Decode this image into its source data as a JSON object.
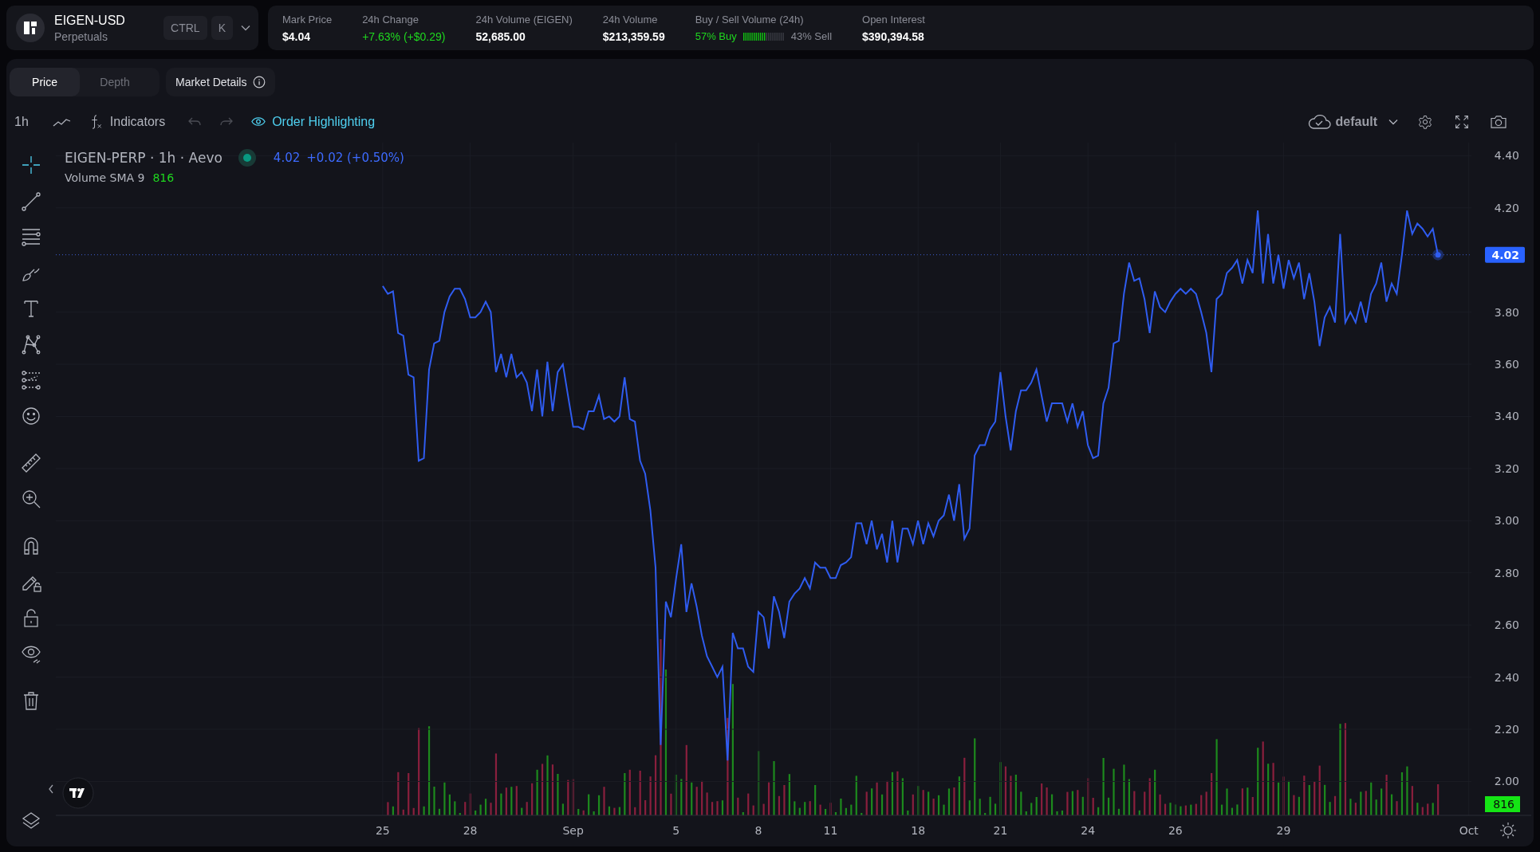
{
  "market": {
    "symbol": "EIGEN-USD",
    "type": "Perpetuals",
    "shortcut_keys": [
      "CTRL",
      "K"
    ]
  },
  "stats": [
    {
      "kind": "plain",
      "label": "Mark Price",
      "value": "$4.04"
    },
    {
      "kind": "change",
      "label": "24h Change",
      "value": "+7.63% (+$0.29)"
    },
    {
      "kind": "plain",
      "label": "24h Volume (EIGEN)",
      "value": "52,685.00"
    },
    {
      "kind": "plain",
      "label": "24h Volume",
      "value": "$213,359.59"
    },
    {
      "kind": "buysell",
      "label": "Buy / Sell Volume (24h)",
      "buy": "57% Buy",
      "sell": "43% Sell",
      "level": 0.57
    },
    {
      "kind": "plain",
      "label": "Open Interest",
      "value": "$390,394.58"
    }
  ],
  "tabs": [
    {
      "label": "Price",
      "selected": true
    },
    {
      "label": "Depth",
      "selected": false
    }
  ],
  "market_details": "Market Details",
  "toolbar": {
    "interval": "1h",
    "indicators": "Indicators",
    "undo_disabled": true,
    "redo_disabled": true,
    "order_highlighting": {
      "label": "Order Highlighting",
      "on": true
    },
    "layout": "default"
  },
  "tools": [
    {
      "kind": "crosshair",
      "selected": true
    },
    {
      "kind": "trendline",
      "selected": false
    },
    {
      "kind": "hlines",
      "selected": false
    },
    {
      "kind": "brush",
      "selected": false
    },
    {
      "kind": "text",
      "selected": false
    },
    {
      "kind": "pattern",
      "selected": false
    },
    {
      "kind": "forecast",
      "selected": false
    },
    {
      "kind": "smiley",
      "selected": false
    },
    {
      "kind": "ruler",
      "selected": false
    },
    {
      "kind": "zoom",
      "selected": false
    },
    {
      "kind": "magnet",
      "selected": false
    },
    {
      "kind": "drawlock",
      "selected": false
    },
    {
      "kind": "lock",
      "selected": false
    },
    {
      "kind": "eye",
      "selected": false
    },
    {
      "kind": "trash",
      "selected": false
    }
  ],
  "chart": {
    "legend": {
      "title": "EIGEN-PERP · 1h · Aevo",
      "price": "4.02",
      "change": "+0.02 (+0.50%)",
      "indicator": "Volume SMA 9",
      "indicator_value": "816"
    },
    "last_price": "4.02",
    "volume_label": "816",
    "chart_data": {
      "type": "line",
      "grid": true,
      "ylim": [
        1.87,
        4.45
      ],
      "categories": [
        null,
        null,
        null,
        null,
        null,
        null,
        null,
        null,
        null,
        null,
        null,
        null,
        null,
        null,
        null,
        null,
        null,
        null,
        null,
        null,
        null,
        null,
        null,
        null,
        null,
        null,
        null,
        null,
        null,
        null,
        null,
        null,
        null,
        null,
        null,
        null,
        null,
        null,
        null,
        null,
        null,
        null,
        null,
        null,
        null,
        null,
        null,
        null,
        null,
        null,
        null,
        null,
        null,
        null,
        null,
        null,
        null,
        null,
        null,
        null,
        null,
        null,
        null,
        "25",
        null,
        null,
        null,
        null,
        null,
        null,
        null,
        null,
        null,
        null,
        null,
        null,
        null,
        null,
        null,
        null,
        "28",
        null,
        null,
        null,
        null,
        null,
        null,
        null,
        null,
        null,
        null,
        null,
        null,
        null,
        null,
        null,
        null,
        null,
        null,
        null,
        "Sep",
        null,
        null,
        null,
        null,
        null,
        null,
        null,
        null,
        null,
        null,
        null,
        null,
        null,
        null,
        null,
        null,
        null,
        null,
        null,
        "5",
        null,
        null,
        null,
        null,
        null,
        null,
        null,
        null,
        null,
        null,
        null,
        null,
        null,
        null,
        null,
        "8",
        null,
        null,
        null,
        null,
        null,
        null,
        null,
        null,
        null,
        null,
        null,
        null,
        null,
        "11",
        null,
        null,
        null,
        null,
        null,
        null,
        null,
        null,
        null,
        null,
        null,
        null,
        null,
        null,
        null,
        null,
        "18",
        null,
        null,
        null,
        null,
        null,
        null,
        null,
        null,
        null,
        null,
        null,
        null,
        null,
        null,
        null,
        "21",
        null,
        null,
        null,
        null,
        null,
        null,
        null,
        null,
        null,
        null,
        null,
        null,
        null,
        null,
        null,
        null,
        "24",
        null,
        null,
        null,
        null,
        null,
        null,
        null,
        null,
        null,
        null,
        null,
        null,
        null,
        null,
        null,
        null,
        "26",
        null,
        null,
        null,
        null,
        null,
        null,
        null,
        null,
        null,
        null,
        null,
        null,
        null,
        null,
        null,
        null,
        null,
        null,
        null,
        null,
        "29",
        null,
        null,
        null,
        null,
        null,
        null,
        null,
        null,
        null,
        null,
        null,
        null,
        null,
        null,
        null,
        null,
        null,
        null,
        null,
        null,
        null,
        null,
        null,
        null,
        null,
        null,
        null,
        null,
        null,
        null,
        null,
        null,
        null,
        null,
        null,
        "Oct"
      ],
      "yticks": [
        {
          "value": 4.4,
          "label": "4.40"
        },
        {
          "value": 4.2,
          "label": "4.20"
        },
        {
          "value": 3.8,
          "label": "3.80"
        },
        {
          "value": 3.6,
          "label": "3.60"
        },
        {
          "value": 3.4,
          "label": "3.40"
        },
        {
          "value": 3.2,
          "label": "3.20"
        },
        {
          "value": 3.0,
          "label": "3.00"
        },
        {
          "value": 2.8,
          "label": "2.80"
        },
        {
          "value": 2.6,
          "label": "2.60"
        },
        {
          "value": 2.4,
          "label": "2.40"
        },
        {
          "value": 2.2,
          "label": "2.20"
        },
        {
          "value": 2.0,
          "label": "2.00"
        }
      ],
      "series": [
        {
          "color": "#2f5cf0",
          "values": [
            null,
            null,
            null,
            null,
            null,
            null,
            null,
            null,
            null,
            null,
            null,
            null,
            null,
            null,
            null,
            null,
            null,
            null,
            null,
            null,
            null,
            null,
            null,
            null,
            null,
            null,
            null,
            null,
            null,
            null,
            null,
            null,
            null,
            null,
            null,
            null,
            null,
            null,
            null,
            null,
            null,
            null,
            null,
            null,
            null,
            null,
            null,
            null,
            null,
            null,
            null,
            null,
            null,
            null,
            null,
            null,
            null,
            null,
            null,
            null,
            null,
            null,
            null,
            3.9,
            3.87,
            3.88,
            3.72,
            3.71,
            3.56,
            3.55,
            3.23,
            3.24,
            3.58,
            3.68,
            3.69,
            3.8,
            3.86,
            3.89,
            3.89,
            3.85,
            3.78,
            3.78,
            3.8,
            3.84,
            3.8,
            3.57,
            3.64,
            3.55,
            3.64,
            3.55,
            3.57,
            3.53,
            3.42,
            3.58,
            3.4,
            3.61,
            3.42,
            3.57,
            3.6,
            3.48,
            3.36,
            3.36,
            3.35,
            3.42,
            3.42,
            3.48,
            3.39,
            3.4,
            3.38,
            3.4,
            3.55,
            3.39,
            3.38,
            3.23,
            3.18,
            3.04,
            2.82,
            2.14,
            2.69,
            2.63,
            2.78,
            2.91,
            2.65,
            2.76,
            2.67,
            2.56,
            2.48,
            2.44,
            2.4,
            2.44,
            2.08,
            2.57,
            2.51,
            2.51,
            2.44,
            2.42,
            2.65,
            2.63,
            2.51,
            2.71,
            2.65,
            2.55,
            2.69,
            2.72,
            2.74,
            2.78,
            2.74,
            2.84,
            2.82,
            2.82,
            2.78,
            2.78,
            2.83,
            2.84,
            2.86,
            2.99,
            2.99,
            2.91,
            3.0,
            2.89,
            2.95,
            2.84,
            3.0,
            2.84,
            2.97,
            2.97,
            2.91,
            3.0,
            2.91,
            2.99,
            2.94,
            3.0,
            3.02,
            3.1,
            3.0,
            3.14,
            2.93,
            2.97,
            3.25,
            3.29,
            3.29,
            3.35,
            3.38,
            3.57,
            3.4,
            3.27,
            3.42,
            3.5,
            3.5,
            3.53,
            3.58,
            3.48,
            3.38,
            3.45,
            3.45,
            3.45,
            3.38,
            3.45,
            3.36,
            3.42,
            3.29,
            3.24,
            3.25,
            3.45,
            3.51,
            3.68,
            3.69,
            3.87,
            3.99,
            3.92,
            3.93,
            3.85,
            3.72,
            3.88,
            3.82,
            3.8,
            3.84,
            3.87,
            3.89,
            3.87,
            3.89,
            3.87,
            3.8,
            3.72,
            3.57,
            3.85,
            3.87,
            3.95,
            3.97,
            4.0,
            3.91,
            4.0,
            3.95,
            4.19,
            3.91,
            4.1,
            3.91,
            4.02,
            3.89,
            4.0,
            3.93,
            3.99,
            3.85,
            3.95,
            3.84,
            3.67,
            3.78,
            3.82,
            3.76,
            4.1,
            3.76,
            3.8,
            3.76,
            3.84,
            3.76,
            3.87,
            3.91,
            3.99,
            3.84,
            3.91,
            3.87,
            4.02,
            4.19,
            4.1,
            4.14,
            4.12,
            4.09,
            4.12,
            4.02,
            null,
            null,
            null,
            null,
            null,
            null
          ]
        }
      ]
    }
  }
}
